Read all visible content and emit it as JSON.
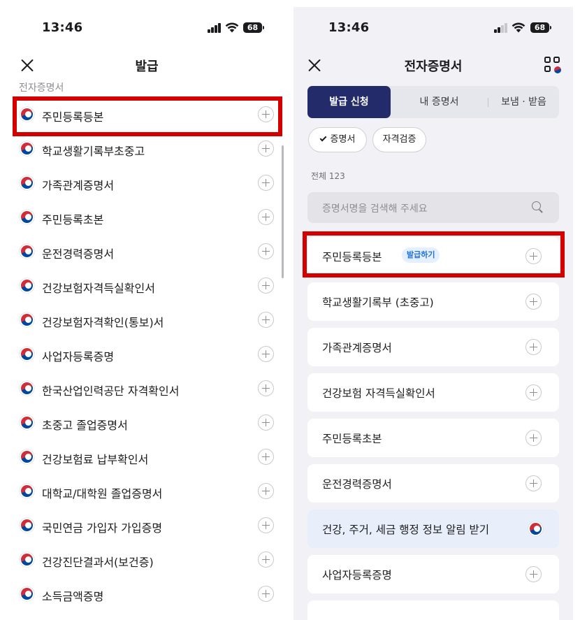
{
  "left": {
    "status": {
      "time": "13:46",
      "battery": "68"
    },
    "title": "발급",
    "section_label": "전자증명서",
    "items": [
      {
        "label": "주민등록등본"
      },
      {
        "label": "학교생활기록부초중고"
      },
      {
        "label": "가족관계증명서"
      },
      {
        "label": "주민등록초본"
      },
      {
        "label": "운전경력증명서"
      },
      {
        "label": "건강보험자격득실확인서"
      },
      {
        "label": "건강보험자격확인(통보)서"
      },
      {
        "label": "사업자등록증명"
      },
      {
        "label": "한국산업인력공단 자격확인서"
      },
      {
        "label": "초중고 졸업증명서"
      },
      {
        "label": "건강보험료 납부확인서"
      },
      {
        "label": "대학교/대학원 졸업증명서"
      },
      {
        "label": "국민연금 가입자 가입증명"
      },
      {
        "label": "건강진단결과서(보건증)"
      },
      {
        "label": "소득금액증명"
      }
    ]
  },
  "right": {
    "status": {
      "time": "13:46",
      "battery": "68"
    },
    "title": "전자증명서",
    "tabs": [
      {
        "label": "발급 신청",
        "active": true
      },
      {
        "label": "내 증명서",
        "active": false
      },
      {
        "label": "보냄 · 받음",
        "active": false
      }
    ],
    "chips": [
      {
        "label": "증명서",
        "selected": true
      },
      {
        "label": "자격검증",
        "selected": false
      }
    ],
    "total_count": "전체 123",
    "search_placeholder": "증명서명을 검색해 주세요",
    "items": [
      {
        "label": "주민등록등본",
        "badge": "발급하기"
      },
      {
        "label": "학교생활기록부 (초중고)"
      },
      {
        "label": "가족관계증명서"
      },
      {
        "label": "건강보험 자격득실확인서"
      },
      {
        "label": "주민등록초본"
      },
      {
        "label": "운전경력증명서"
      },
      {
        "label": "건강, 주거, 세금 행정 정보 알림 받기",
        "promo": true
      },
      {
        "label": "사업자등록증명"
      }
    ]
  },
  "colors": {
    "highlight": "#d40000",
    "tab_active": "#232b6b",
    "badge_text": "#1f6fe0"
  }
}
